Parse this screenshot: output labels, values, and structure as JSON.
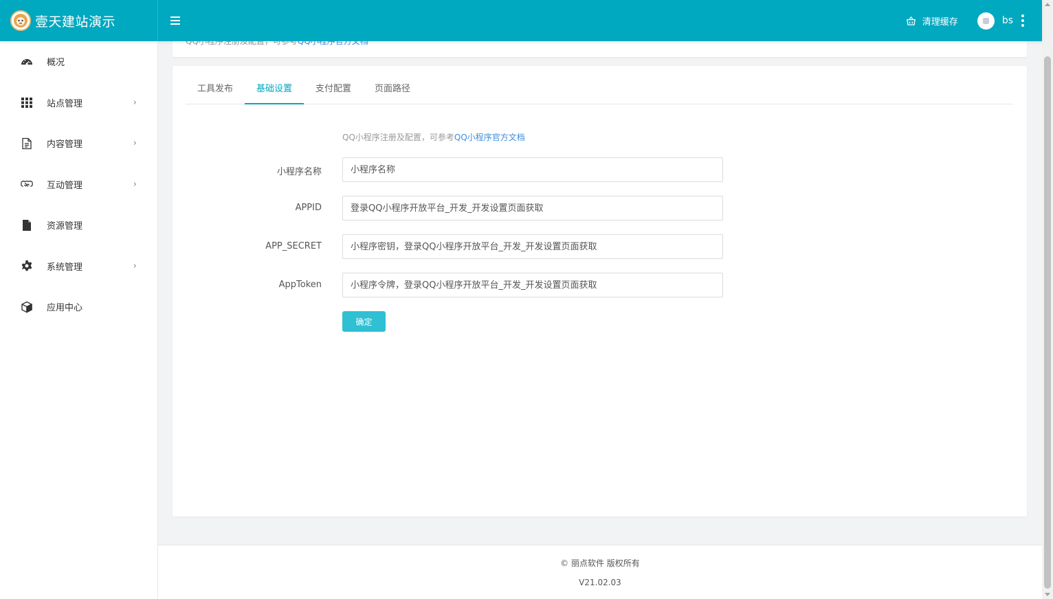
{
  "header": {
    "app_title": "壹天建站演示",
    "clear_cache_label": "清理缓存",
    "username": "bs"
  },
  "sidebar": {
    "items": [
      {
        "label": "概况",
        "icon": "dashboard-icon",
        "has_children": false
      },
      {
        "label": "站点管理",
        "icon": "grid-icon",
        "has_children": true
      },
      {
        "label": "内容管理",
        "icon": "document-icon",
        "has_children": true
      },
      {
        "label": "互动管理",
        "icon": "handshake-icon",
        "has_children": true
      },
      {
        "label": "资源管理",
        "icon": "file-icon",
        "has_children": false
      },
      {
        "label": "系统管理",
        "icon": "gear-icon",
        "has_children": true
      },
      {
        "label": "应用中心",
        "icon": "cube-icon",
        "has_children": false
      }
    ],
    "chevron": "›"
  },
  "top_card": {
    "tip_prefix": "QQ小程序注册及配置，可参考",
    "tip_link": "QQ小程序官方文档"
  },
  "tabs": [
    {
      "label": "工具发布",
      "active": false
    },
    {
      "label": "基础设置",
      "active": true
    },
    {
      "label": "支付配置",
      "active": false
    },
    {
      "label": "页面路径",
      "active": false
    }
  ],
  "form": {
    "tip_prefix": "QQ小程序注册及配置，可参考",
    "tip_link": "QQ小程序官方文档",
    "fields": [
      {
        "label": "小程序名称",
        "placeholder": "小程序名称"
      },
      {
        "label": "APPID",
        "placeholder": "登录QQ小程序开放平台_开发_开发设置页面获取"
      },
      {
        "label": "APP_SECRET",
        "placeholder": "小程序密钥，登录QQ小程序开放平台_开发_开发设置页面获取"
      },
      {
        "label": "AppToken",
        "placeholder": "小程序令牌，登录QQ小程序开放平台_开发_开发设置页面获取"
      }
    ],
    "submit_label": "确定"
  },
  "footer": {
    "copyright": "© 丽点软件 版权所有",
    "version": "V21.02.03"
  },
  "colors": {
    "primary": "#00a8c0",
    "button": "#2fc0d4",
    "link": "#3d8ee0"
  }
}
